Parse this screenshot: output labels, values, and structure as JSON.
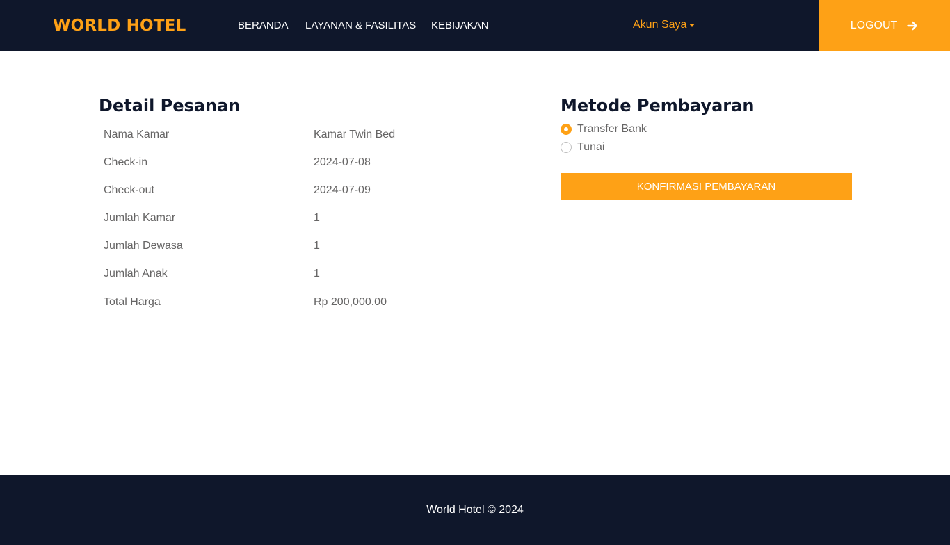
{
  "navbar": {
    "brand": "WORLD HOTEL",
    "links": [
      "BERANDA",
      "LAYANAN & FASILITAS",
      "KEBIJAKAN"
    ],
    "account_label": "Akun Saya",
    "logout_label": "LOGOUT"
  },
  "detail": {
    "title": "Detail Pesanan",
    "rows": [
      {
        "label": "Nama Kamar",
        "value": "Kamar Twin Bed"
      },
      {
        "label": "Check-in",
        "value": "2024-07-08"
      },
      {
        "label": "Check-out",
        "value": "2024-07-09"
      },
      {
        "label": "Jumlah Kamar",
        "value": "1"
      },
      {
        "label": "Jumlah Dewasa",
        "value": "1"
      },
      {
        "label": "Jumlah Anak",
        "value": "1"
      }
    ],
    "total": {
      "label": "Total Harga",
      "value": "Rp 200,000.00"
    }
  },
  "payment": {
    "title": "Metode Pembayaran",
    "options": [
      {
        "label": "Transfer Bank",
        "checked": true
      },
      {
        "label": "Tunai",
        "checked": false
      }
    ],
    "confirm_label": "KONFIRMASI PEMBAYARAN"
  },
  "footer": {
    "text": "World Hotel © 2024"
  },
  "colors": {
    "navy": "#0f172b",
    "accent": "#fea116",
    "text": "#666565"
  }
}
